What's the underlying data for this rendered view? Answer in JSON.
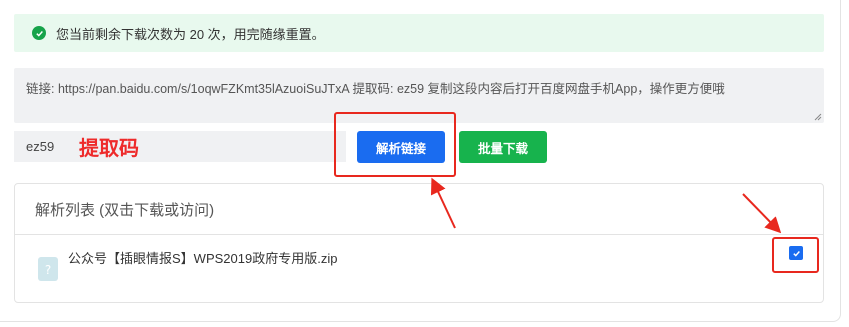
{
  "alert": {
    "text": "您当前剩余下载次数为 20 次，用完随缘重置。"
  },
  "link_input": {
    "value": "链接: https://pan.baidu.com/s/1oqwFZKmt35lAzuoiSuJTxA 提取码: ez59 复制这段内容后打开百度网盘手机App，操作更方便哦"
  },
  "code_input": {
    "value": "ez59"
  },
  "annotation": {
    "code_label": "提取码"
  },
  "buttons": {
    "parse": "解析链接",
    "batch": "批量下载"
  },
  "panel": {
    "title": "解析列表 (双击下载或访问)",
    "files": [
      {
        "name": "公众号【插眼情报S】WPS2019政府专用版.zip",
        "checked": true
      }
    ]
  },
  "colors": {
    "primary": "#1a6cf0",
    "success": "#17b34d",
    "annotation_red": "#e8281e"
  }
}
